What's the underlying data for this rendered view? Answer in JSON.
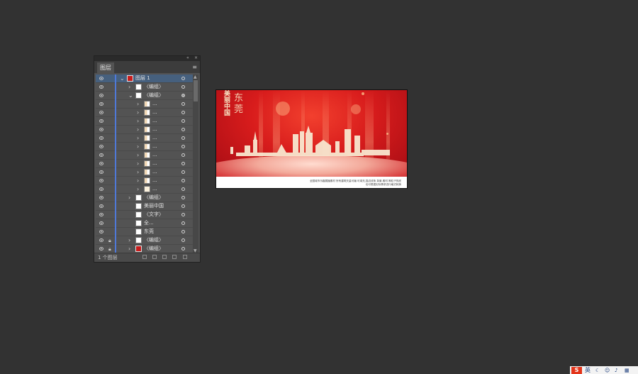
{
  "panel": {
    "tab_label": "图层",
    "collapse_glyph": "«",
    "close_glyph": "×",
    "menu_glyph": "≡",
    "footer_text": "1 个图层"
  },
  "layers": [
    {
      "label": "图层 1",
      "depth": 0,
      "expanded": true,
      "selected": true,
      "thumb": "red",
      "lock": false,
      "target_filled": false
    },
    {
      "label": "〈编组〉",
      "depth": 1,
      "expanded": false,
      "thumb": "white",
      "lock": false
    },
    {
      "label": "〈编组〉",
      "depth": 1,
      "expanded": true,
      "thumb": "white",
      "lock": false,
      "target_filled": true
    },
    {
      "label": "...",
      "depth": 2,
      "expanded": false,
      "thumb": "half",
      "lock": false
    },
    {
      "label": "...",
      "depth": 2,
      "expanded": false,
      "thumb": "half",
      "lock": false
    },
    {
      "label": "...",
      "depth": 2,
      "expanded": false,
      "thumb": "half",
      "lock": false
    },
    {
      "label": "...",
      "depth": 2,
      "expanded": false,
      "thumb": "half",
      "lock": false
    },
    {
      "label": "...",
      "depth": 2,
      "expanded": false,
      "thumb": "half",
      "lock": false
    },
    {
      "label": "...",
      "depth": 2,
      "expanded": false,
      "thumb": "half",
      "lock": false
    },
    {
      "label": "...",
      "depth": 2,
      "expanded": false,
      "thumb": "half",
      "lock": false
    },
    {
      "label": "...",
      "depth": 2,
      "expanded": false,
      "thumb": "half",
      "lock": false
    },
    {
      "label": "...",
      "depth": 2,
      "expanded": false,
      "thumb": "half",
      "lock": false
    },
    {
      "label": "...",
      "depth": 2,
      "expanded": false,
      "thumb": "half",
      "lock": false
    },
    {
      "label": "...",
      "depth": 2,
      "expanded": false,
      "thumb": "gold",
      "lock": false
    },
    {
      "label": "〈编组〉",
      "depth": 1,
      "expanded": false,
      "thumb": "white",
      "lock": false
    },
    {
      "label": "美丽中国",
      "depth": 1,
      "expanded": null,
      "thumb": "white",
      "lock": false
    },
    {
      "label": "〈文字〉",
      "depth": 1,
      "expanded": null,
      "thumb": "white",
      "lock": false
    },
    {
      "label": "全...",
      "depth": 1,
      "expanded": null,
      "thumb": "white",
      "lock": false
    },
    {
      "label": "东莞",
      "depth": 1,
      "expanded": null,
      "thumb": "white",
      "lock": false
    },
    {
      "label": "〈编组〉",
      "depth": 1,
      "expanded": false,
      "thumb": "white",
      "lock": true
    },
    {
      "label": "〈编组〉",
      "depth": 1,
      "expanded": false,
      "thumb": "red",
      "lock": true
    }
  ],
  "artboard": {
    "title_vertical": "美丽中国",
    "city_vertical": "东莞",
    "caption_line1": "全国城市乐趣展播素材 所有建筑矢量可编 可填充,描边线条,背景,素材,等粒子的底",
    "caption_line2": "也可根据实际需求进行格式转换",
    "colors": {
      "primary": "#d81c1c",
      "gold": "#f6e3c2"
    }
  },
  "tray": {
    "ime_logo": "S",
    "ime_mode": "英",
    "icons": [
      "moon-icon",
      "emoji-icon",
      "mic-icon",
      "keyboard-icon"
    ]
  }
}
